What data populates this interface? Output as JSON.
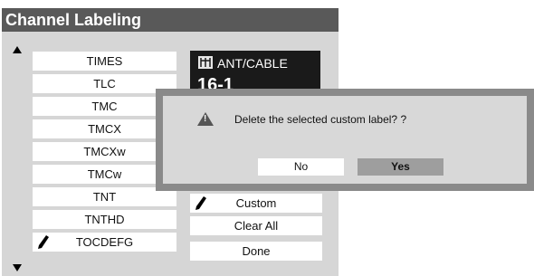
{
  "screen": {
    "title": "Channel Labeling"
  },
  "label_list": {
    "items": [
      {
        "label": "TIMES",
        "custom": false
      },
      {
        "label": "TLC",
        "custom": false
      },
      {
        "label": "TMC",
        "custom": false
      },
      {
        "label": "TMCX",
        "custom": false
      },
      {
        "label": "TMCXw",
        "custom": false
      },
      {
        "label": "TMCw",
        "custom": false
      },
      {
        "label": "TNT",
        "custom": false
      },
      {
        "label": "TNTHD",
        "custom": false
      },
      {
        "label": "TOCDEFG",
        "custom": true
      }
    ]
  },
  "source": {
    "icon": "antenna-icon",
    "label": "ANT/CABLE",
    "channel": "16-1"
  },
  "actions": {
    "custom": "Custom",
    "clear_all": "Clear All",
    "done": "Done"
  },
  "dialog": {
    "icon": "warning-icon",
    "message": "Delete the selected custom label? ?",
    "no_label": "No",
    "yes_label": "Yes",
    "selected": "yes"
  },
  "colors": {
    "title_bar": "#595959",
    "panel": "#d6d6d6",
    "info_box": "#1a1a1a",
    "dialog_border": "#8a8a8a",
    "selected_button": "#9e9e9e"
  }
}
